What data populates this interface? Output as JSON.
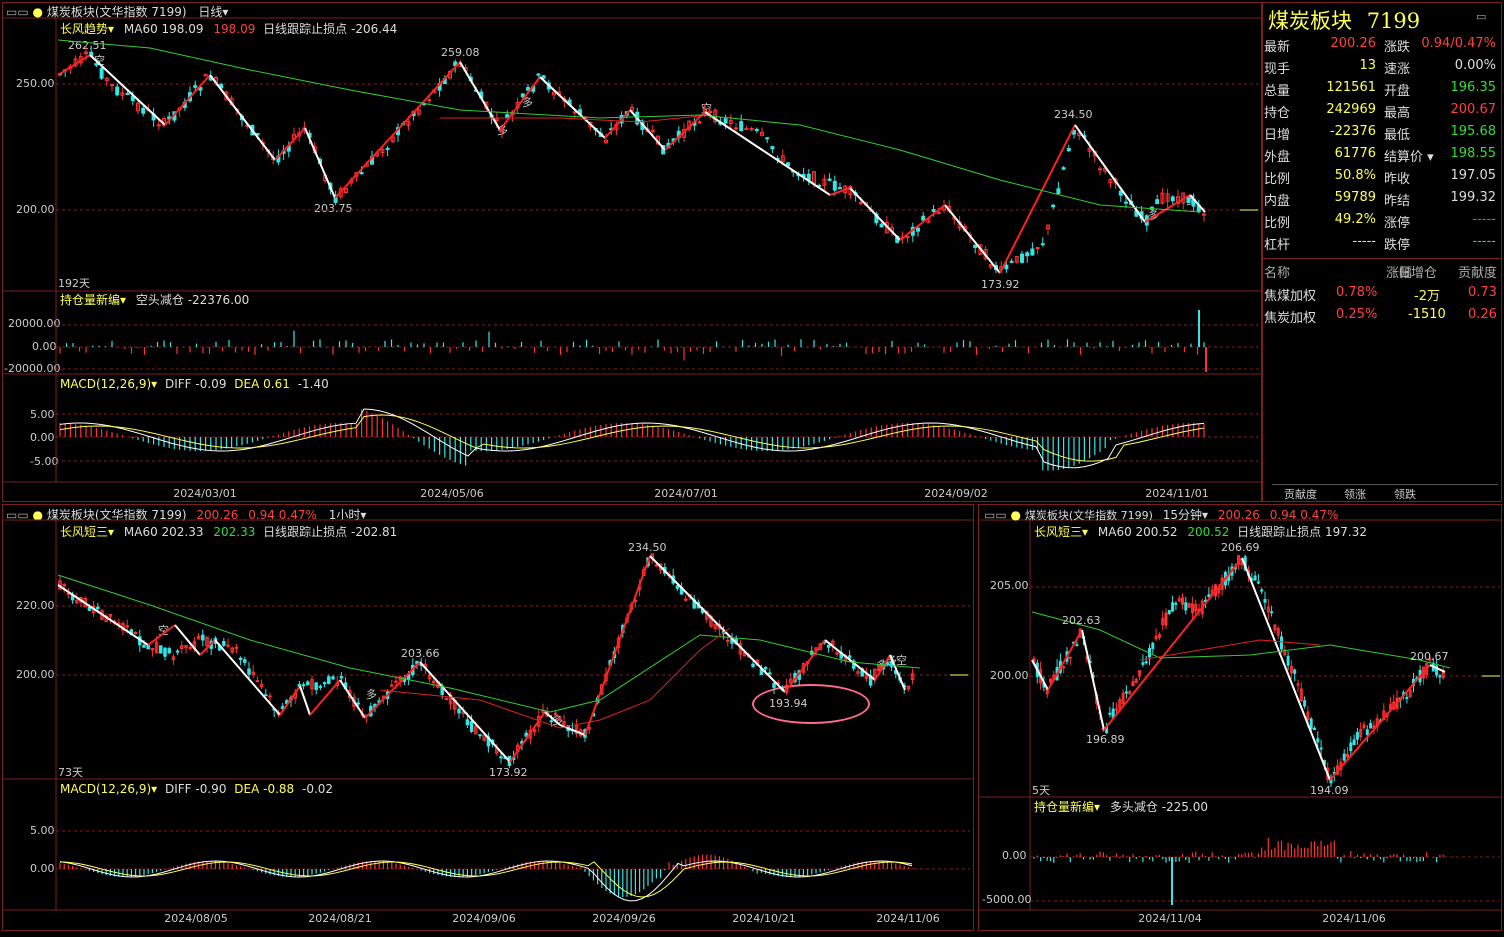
{
  "colors": {
    "up": "#ff3333",
    "down": "#33e5e5",
    "ma": "#33cc33",
    "ma_red": "#dd2222",
    "zig_up": "#ff2020",
    "zig_down": "#ffffff",
    "text_y": "#ffff55",
    "grid": "#7a1e1e"
  },
  "top": {
    "title": "煤炭板块(文华指数 7199)",
    "period": "日线",
    "indicator": "长风趋势",
    "ma_label": "MA60 198.09",
    "ma_value": "198.09",
    "stop_label": "日线跟踪止损点 -206.44",
    "y_ticks": [
      "250.00",
      "200.00"
    ],
    "annotations": {
      "peak1": "262.51",
      "trough1": "203.75",
      "peak2": "259.08",
      "peak3": "234.50",
      "trough2": "173.92"
    },
    "days": "192天",
    "oi_title": "持仓量新编",
    "oi_desc": "空头减仓 -22376.00",
    "oi_ticks": [
      "20000.00",
      "0.00",
      "-20000.00"
    ],
    "macd_title": "MACD(12,26,9)",
    "macd_diff": "DIFF -0.09",
    "macd_dea": "DEA 0.61",
    "macd_val": "-1.40",
    "macd_ticks": [
      "5.00",
      "0.00",
      "-5.00"
    ],
    "dates": [
      "2024/03/01",
      "2024/05/06",
      "2024/07/01",
      "2024/09/02",
      "2024/11/01"
    ],
    "signals": [
      "空",
      "多",
      "多",
      "空",
      "多",
      "多"
    ]
  },
  "quote": {
    "name": "煤炭板块",
    "code": "7199",
    "left": [
      {
        "label": "最新",
        "value": "200.26",
        "color": "r"
      },
      {
        "label": "现手",
        "value": "13",
        "color": "y"
      },
      {
        "label": "总量",
        "value": "121561",
        "color": "y"
      },
      {
        "label": "持仓",
        "value": "242969",
        "color": "y"
      },
      {
        "label": "日增",
        "value": "-22376",
        "color": "y"
      },
      {
        "label": "外盘",
        "value": "61776",
        "color": "y"
      },
      {
        "label": "比例",
        "value": "50.8%",
        "color": "y"
      },
      {
        "label": "内盘",
        "value": "59789",
        "color": "y"
      },
      {
        "label": "比例",
        "value": "49.2%",
        "color": "y"
      },
      {
        "label": "杠杆",
        "value": "-----",
        "color": "w"
      }
    ],
    "right": [
      {
        "label": "涨跌",
        "value": "0.94/0.47%",
        "color": "r"
      },
      {
        "label": "速涨",
        "value": "0.00%",
        "color": "w"
      },
      {
        "label": "开盘",
        "value": "196.35",
        "color": "g"
      },
      {
        "label": "最高",
        "value": "200.67",
        "color": "r"
      },
      {
        "label": "最低",
        "value": "195.68",
        "color": "g"
      },
      {
        "label": "结算价",
        "value": "198.55",
        "color": "g"
      },
      {
        "label": "昨收",
        "value": "197.05",
        "color": "w"
      },
      {
        "label": "昨结",
        "value": "199.32",
        "color": "w"
      },
      {
        "label": "涨停",
        "value": "-----",
        "color": "r"
      },
      {
        "label": "跌停",
        "value": "-----",
        "color": "g"
      }
    ],
    "table_headers": [
      "名称",
      "涨幅",
      "日增仓",
      "贡献度"
    ],
    "table_rows": [
      {
        "name": "焦煤加权",
        "change": "0.78%",
        "oi": "-2万",
        "contrib": "0.73"
      },
      {
        "name": "焦炭加权",
        "change": "0.25%",
        "oi": "-1510",
        "contrib": "0.26"
      }
    ],
    "tabs": [
      "贡献度",
      "领涨",
      "领跌"
    ]
  },
  "bl": {
    "title": "煤炭板块(文华指数 7199)",
    "last": "200.26",
    "chg": "0.94",
    "pct": "0.47%",
    "period": "1小时",
    "indicator": "长风短三",
    "ma_label": "MA60 202.33",
    "ma_value": "202.33",
    "stop_label": "日线跟踪止损点 -202.81",
    "y_ticks": [
      "220.00",
      "200.00"
    ],
    "annotations": {
      "p1": "203.66",
      "p2": "234.50",
      "t1": "173.92",
      "t2": "193.94"
    },
    "days": "73天",
    "macd_title": "MACD(12,26,9)",
    "macd_diff": "DIFF -0.90",
    "macd_dea": "DEA -0.88",
    "macd_val": "-0.02",
    "macd_ticks": [
      "5.00",
      "0.00"
    ],
    "dates": [
      "2024/08/05",
      "2024/08/21",
      "2024/09/06",
      "2024/09/26",
      "2024/10/21",
      "2024/11/06"
    ],
    "signals": [
      "空",
      "多",
      "多",
      "多",
      "多",
      "空"
    ]
  },
  "br": {
    "title": "煤炭板块(文华指数 7199)",
    "last": "200.26",
    "chg": "0.94",
    "pct": "0.47%",
    "period": "15分钟",
    "indicator": "长风短三",
    "ma_label": "MA60 200.52",
    "ma_value": "200.52",
    "stop_label": "日线跟踪止损点 197.32",
    "y_ticks": [
      "205.00",
      "200.00"
    ],
    "annotations": {
      "p1": "202.63",
      "p2": "206.69",
      "p3": "200.67",
      "t1": "196.89",
      "t2": "194.09"
    },
    "days": "5天",
    "oi_title": "持仓量新编",
    "oi_desc": "多头减仓 -225.00",
    "oi_ticks": [
      "0.00",
      "-5000.00"
    ],
    "dates": [
      "2024/11/04",
      "2024/11/06"
    ]
  }
}
